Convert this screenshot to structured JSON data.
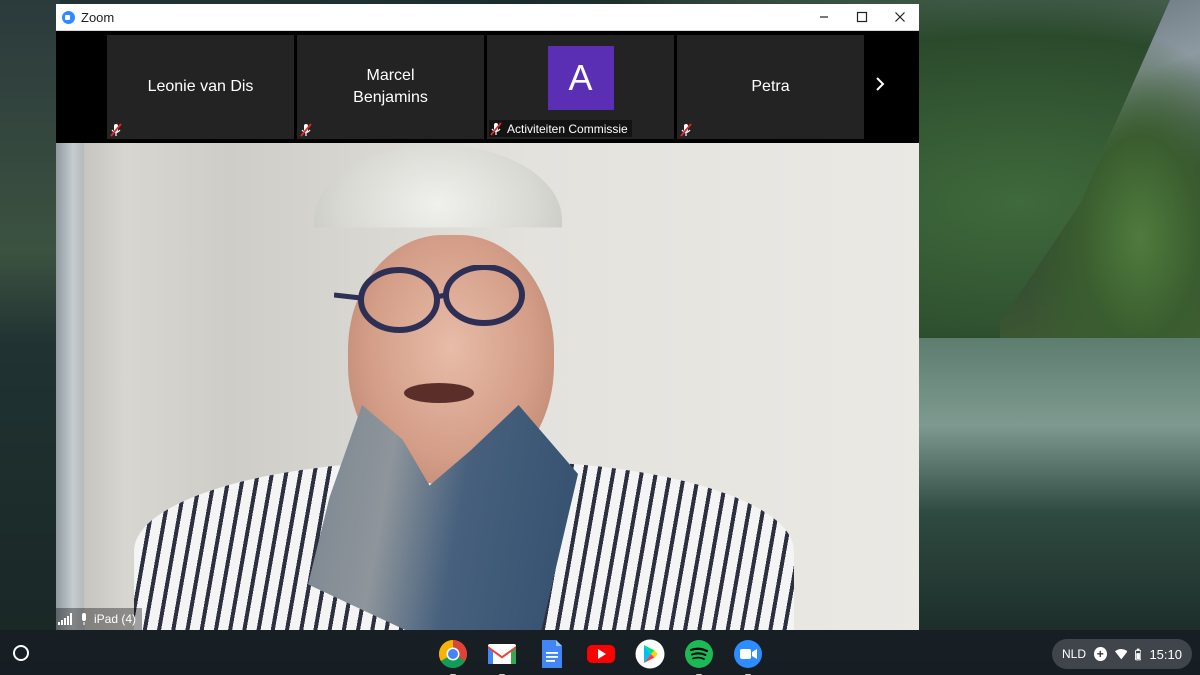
{
  "window": {
    "title": "Zoom",
    "minimize": "–",
    "maximize": "☐",
    "close": "✕"
  },
  "participants": [
    {
      "name": "Leonie van Dis",
      "muted": true
    },
    {
      "name": "Marcel\nBenjamins",
      "muted": true
    },
    {
      "name": "Activiteiten Commissie",
      "avatar_letter": "A",
      "avatar_color": "#5b2fb3",
      "muted": true
    },
    {
      "name": "Petra",
      "muted": true
    }
  ],
  "filmstrip": {
    "next_icon": "›"
  },
  "main_video": {
    "label": "iPad (4)",
    "icons": [
      "signal-icon",
      "microphone-icon"
    ]
  },
  "shelf": {
    "apps": [
      "chrome",
      "gmail",
      "docs",
      "youtube",
      "play-store",
      "spotify",
      "zoom"
    ],
    "tray": {
      "language": "NLD",
      "time": "15:10"
    }
  },
  "colors": {
    "zoom_blue": "#2d8cff",
    "mute_red": "#e02a2a",
    "tile_bg": "#232323"
  }
}
